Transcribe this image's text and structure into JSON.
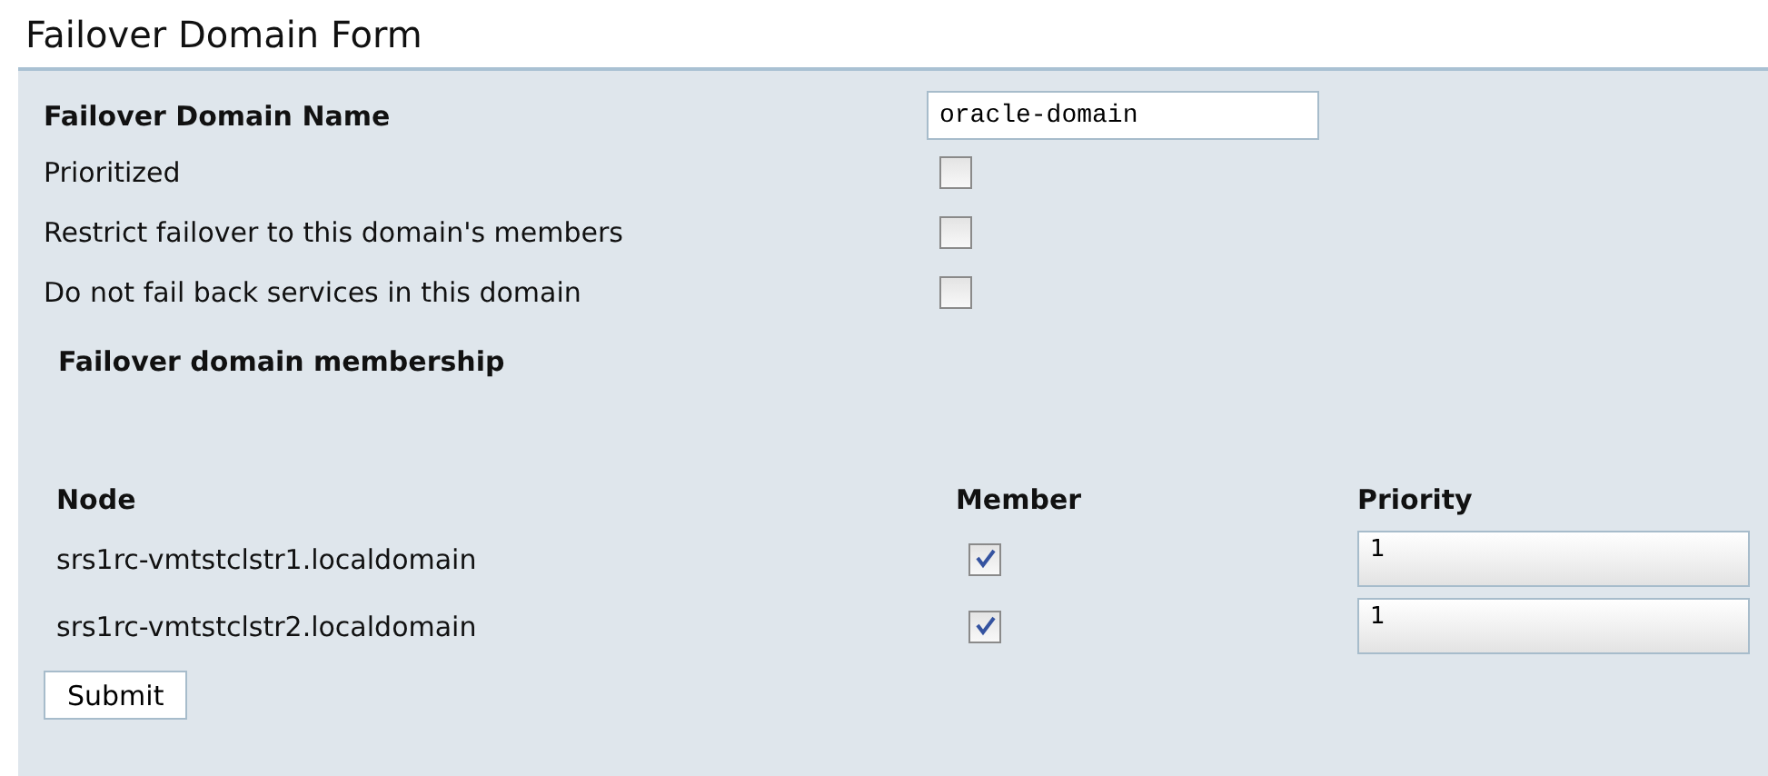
{
  "title": "Failover Domain Form",
  "name_field": {
    "label": "Failover Domain Name",
    "value": "oracle-domain"
  },
  "options": [
    {
      "label": "Prioritized",
      "checked": false
    },
    {
      "label": "Restrict failover to this domain's members",
      "checked": false
    },
    {
      "label": "Do not fail back services in this domain",
      "checked": false
    }
  ],
  "membership": {
    "heading": "Failover domain membership",
    "columns": [
      "Node",
      "Member",
      "Priority"
    ],
    "rows": [
      {
        "node": "srs1rc-vmtstclstr1.localdomain",
        "member": true,
        "priority": "1"
      },
      {
        "node": "srs1rc-vmtstclstr2.localdomain",
        "member": true,
        "priority": "1"
      }
    ]
  },
  "submit": "Submit"
}
